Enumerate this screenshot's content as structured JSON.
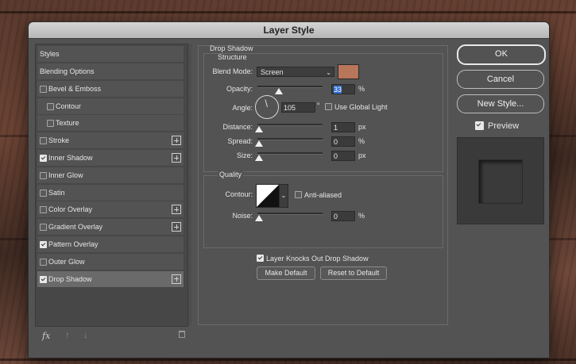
{
  "dialog": {
    "title": "Layer Style"
  },
  "styles_header": "Styles",
  "styles": [
    {
      "label": "Blending Options",
      "checkbox": false,
      "checked": false,
      "plus": false,
      "indent": false,
      "selected": false
    },
    {
      "label": "Bevel & Emboss",
      "checkbox": true,
      "checked": false,
      "plus": false,
      "indent": false,
      "selected": false
    },
    {
      "label": "Contour",
      "checkbox": true,
      "checked": false,
      "plus": false,
      "indent": true,
      "selected": false
    },
    {
      "label": "Texture",
      "checkbox": true,
      "checked": false,
      "plus": false,
      "indent": true,
      "selected": false
    },
    {
      "label": "Stroke",
      "checkbox": true,
      "checked": false,
      "plus": true,
      "indent": false,
      "selected": false
    },
    {
      "label": "Inner Shadow",
      "checkbox": true,
      "checked": true,
      "plus": true,
      "indent": false,
      "selected": false
    },
    {
      "label": "Inner Glow",
      "checkbox": true,
      "checked": false,
      "plus": false,
      "indent": false,
      "selected": false
    },
    {
      "label": "Satin",
      "checkbox": true,
      "checked": false,
      "plus": false,
      "indent": false,
      "selected": false
    },
    {
      "label": "Color Overlay",
      "checkbox": true,
      "checked": false,
      "plus": true,
      "indent": false,
      "selected": false
    },
    {
      "label": "Gradient Overlay",
      "checkbox": true,
      "checked": false,
      "plus": true,
      "indent": false,
      "selected": false
    },
    {
      "label": "Pattern Overlay",
      "checkbox": true,
      "checked": true,
      "plus": false,
      "indent": false,
      "selected": false
    },
    {
      "label": "Outer Glow",
      "checkbox": true,
      "checked": false,
      "plus": false,
      "indent": false,
      "selected": false
    },
    {
      "label": "Drop Shadow",
      "checkbox": true,
      "checked": true,
      "plus": true,
      "indent": false,
      "selected": true
    }
  ],
  "footer_icons": {
    "fx": "fx",
    "up": "↑",
    "down": "↓",
    "trash": "🗑"
  },
  "drop_shadow": {
    "section_title": "Drop Shadow",
    "structure_title": "Structure",
    "blend_mode_label": "Blend Mode:",
    "blend_mode_value": "Screen",
    "color": "#b8765a",
    "opacity_label": "Opacity:",
    "opacity_value": "33",
    "opacity_unit": "%",
    "opacity_level": 0.33,
    "angle_label": "Angle:",
    "angle_value": "105",
    "angle_unit": "°",
    "global_light_label": "Use Global Light",
    "global_light_checked": false,
    "distance_label": "Distance:",
    "distance_value": "1",
    "distance_unit": "px",
    "distance_level": 0.01,
    "spread_label": "Spread:",
    "spread_value": "0",
    "spread_unit": "%",
    "size_label": "Size:",
    "size_value": "0",
    "size_unit": "px",
    "quality_title": "Quality",
    "contour_label": "Contour:",
    "anti_aliased_label": "Anti-aliased",
    "noise_label": "Noise:",
    "noise_value": "0",
    "noise_unit": "%",
    "knockout_label": "Layer Knocks Out Drop Shadow",
    "knockout_checked": true,
    "make_default": "Make Default",
    "reset_default": "Reset to Default"
  },
  "buttons": {
    "ok": "OK",
    "cancel": "Cancel",
    "new_style": "New Style..."
  },
  "preview": {
    "label": "Preview",
    "checked": true
  }
}
